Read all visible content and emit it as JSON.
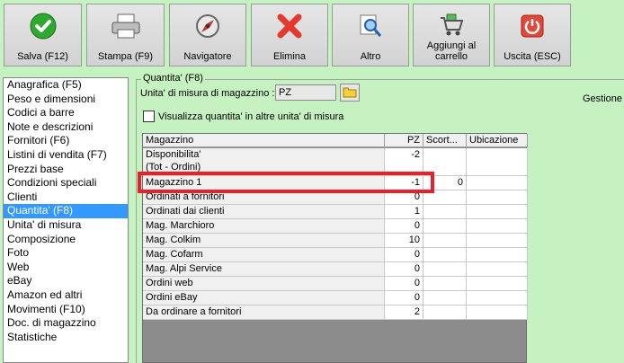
{
  "toolbar": {
    "buttons": [
      {
        "label": "Salva (F12)",
        "icon": "check-icon"
      },
      {
        "label": "Stampa (F9)",
        "icon": "printer-icon"
      },
      {
        "label": "Navigatore",
        "icon": "compass-icon"
      },
      {
        "label": "Elimina",
        "icon": "delete-x-icon"
      },
      {
        "label": "Altro",
        "icon": "search-doc-icon"
      },
      {
        "label": "Aggiungi al\ncarrello",
        "icon": "cart-icon"
      },
      {
        "label": "Uscita (ESC)",
        "icon": "power-icon"
      }
    ]
  },
  "sidebar": {
    "items": [
      {
        "label": "Anagrafica (F5)"
      },
      {
        "label": "Peso e dimensioni"
      },
      {
        "label": "Codici a barre"
      },
      {
        "label": "Note e descrizioni"
      },
      {
        "label": "Fornitori (F6)"
      },
      {
        "label": "Listini di vendita (F7)"
      },
      {
        "label": "Prezzi base"
      },
      {
        "label": "Condizioni speciali"
      },
      {
        "label": "Clienti"
      },
      {
        "label": "Quantita' (F8)"
      },
      {
        "label": "Unita' di misura"
      },
      {
        "label": "Composizione"
      },
      {
        "label": "Foto"
      },
      {
        "label": "Web"
      },
      {
        "label": "eBay"
      },
      {
        "label": "Amazon ed altri"
      },
      {
        "label": "Movimenti (F10)"
      },
      {
        "label": "Doc. di magazzino"
      },
      {
        "label": "Statistiche"
      }
    ],
    "selected_index": 9
  },
  "panel": {
    "group_title": "Quantita' (F8)",
    "um_label": "Unita' di misura di magazzino :",
    "um_value": "PZ",
    "gestione_label": "Gestione",
    "checkbox_label": "Visualizza quantita' in altre unita' di misura",
    "checkbox_checked": false
  },
  "grid": {
    "headers": {
      "magazzino": "Magazzino",
      "pz": "PZ",
      "scorta": "Scort...",
      "ubicazione": "Ubicazione"
    },
    "rows": [
      {
        "name": "Disponibilita'\n(Tot - Ordini)",
        "pz": "-2",
        "scorta": "",
        "ubicazione": ""
      },
      {
        "name": "Magazzino 1",
        "pz": "-1",
        "scorta": "0",
        "ubicazione": ""
      },
      {
        "name": "Ordinati a fornitori",
        "pz": "0",
        "scorta": "",
        "ubicazione": ""
      },
      {
        "name": "Ordinati dai clienti",
        "pz": "1",
        "scorta": "",
        "ubicazione": ""
      },
      {
        "name": "Mag. Marchioro",
        "pz": "0",
        "scorta": "",
        "ubicazione": ""
      },
      {
        "name": "Mag. Colkim",
        "pz": "10",
        "scorta": "",
        "ubicazione": ""
      },
      {
        "name": "Mag. Cofarm",
        "pz": "0",
        "scorta": "",
        "ubicazione": ""
      },
      {
        "name": "Mag. Alpi Service",
        "pz": "0",
        "scorta": "",
        "ubicazione": ""
      },
      {
        "name": "Ordini web",
        "pz": "0",
        "scorta": "",
        "ubicazione": ""
      },
      {
        "name": "Ordini eBay",
        "pz": "0",
        "scorta": "",
        "ubicazione": ""
      },
      {
        "name": "Da ordinare a fornitori",
        "pz": "2",
        "scorta": "",
        "ubicazione": ""
      }
    ]
  },
  "colors": {
    "background": "#c6f1c0",
    "selection": "#3399ff",
    "highlight": "#e8202a"
  }
}
